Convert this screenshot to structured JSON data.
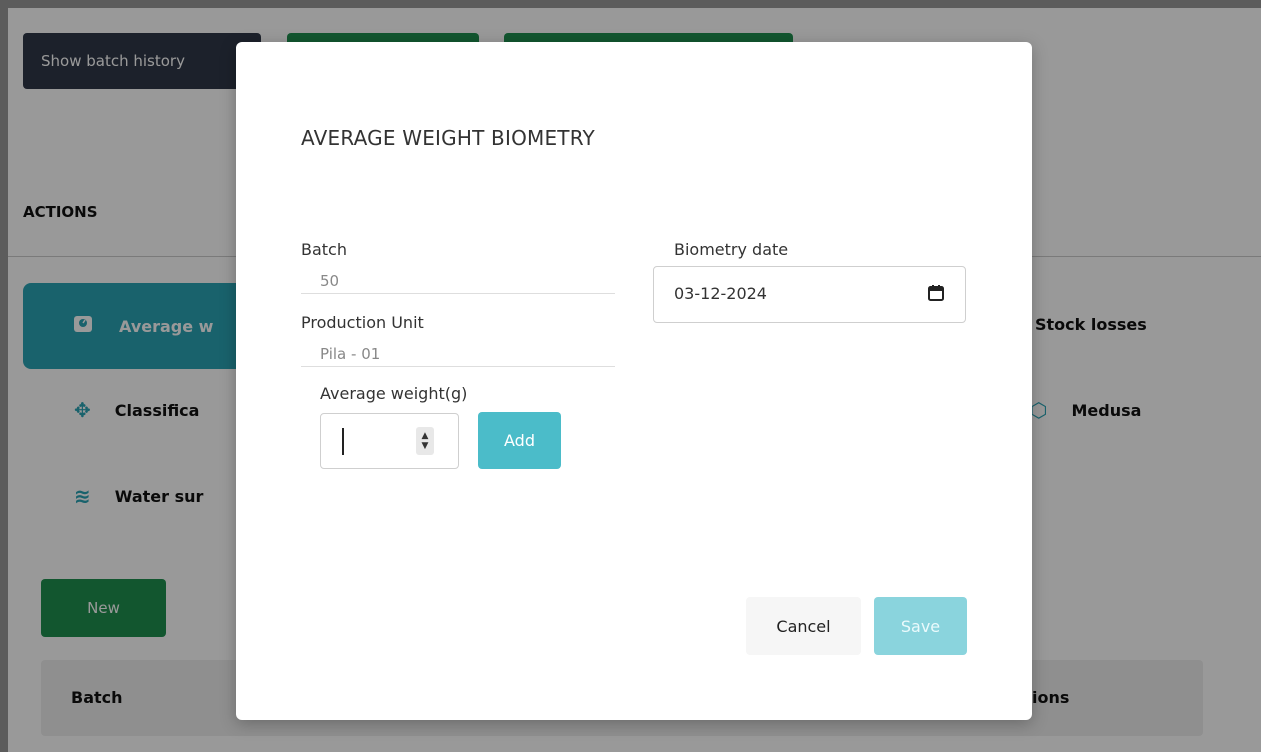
{
  "background": {
    "buttons": {
      "show_batch_history": "Show batch history",
      "green_button_1": "",
      "green_button_2": ""
    },
    "actions_title": "ACTIONS",
    "actions": {
      "active_label": "Average w",
      "classification": "Classifica",
      "water_survey": "Water sur",
      "stock_losses": "Stock losses",
      "medusa": "Medusa"
    },
    "new_button": "New",
    "table": {
      "col_batch": "Batch",
      "col_actions": "ions"
    }
  },
  "modal": {
    "title": "AVERAGE WEIGHT BIOMETRY",
    "batch_label": "Batch",
    "batch_value": "50",
    "unit_label": "Production Unit",
    "unit_value": "Pila - 01",
    "weight_label": "Average weight(g)",
    "weight_value": "",
    "add_button": "Add",
    "date_label": "Biometry date",
    "date_value": "03-12-2024",
    "cancel_button": "Cancel",
    "save_button": "Save"
  },
  "colors": {
    "teal": "#2aa3b5",
    "green": "#1f8f4f",
    "dark": "#2f3848",
    "save_disabled": "#8ad4dd"
  }
}
